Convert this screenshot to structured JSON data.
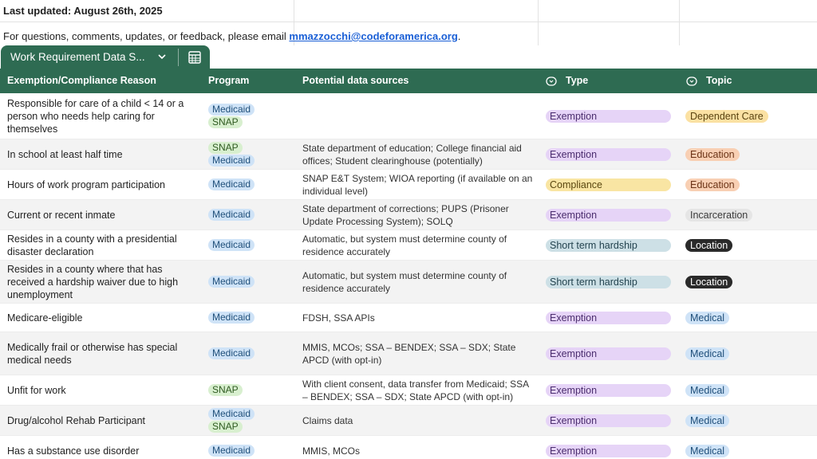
{
  "sheet": {
    "last_updated": "Last updated: August 26th, 2025",
    "contact_prefix": "For questions, comments, updates, or feedback, please email ",
    "contact_email": "mmazzocchi@codeforamerica.org",
    "contact_suffix": "."
  },
  "tab": {
    "name": "Work Requirement Data S...",
    "chevron_icon": "chevron-down-icon",
    "view_icon": "table-calendar-icon"
  },
  "colors": {
    "header_bg": "#2e6b52",
    "medicaid": "#cfe3f7",
    "snap": "#d8efcf",
    "exemption": "#e6d4f7",
    "compliance": "#f9e5a3",
    "short_term_hardship": "#cde0e6",
    "dependent_care": "#fbe1a3",
    "education": "#f8cfb3",
    "incarceration": "#e5e5e5",
    "location": "#2a2a2a",
    "medical": "#cfe3f7"
  },
  "table": {
    "columns": {
      "reason": "Exemption/Compliance Reason",
      "program": "Program",
      "sources": "Potential data sources",
      "type": "Type",
      "topic": "Topic"
    },
    "rows": [
      {
        "reason": "Responsible for care of a child < 14 or a person who needs help caring for themselves",
        "programs": [
          "Medicaid",
          "SNAP"
        ],
        "sources": "",
        "type": "Exemption",
        "topic": "Dependent Care"
      },
      {
        "reason": "In school at least half time",
        "programs": [
          "SNAP",
          "Medicaid"
        ],
        "sources": "State department of education; College financial aid offices; Student clearinghouse (potentially)",
        "type": "Exemption",
        "topic": "Education"
      },
      {
        "reason": "Hours of work program participation",
        "programs": [
          "Medicaid"
        ],
        "sources": "SNAP E&T System; WIOA reporting (if available on an individual level)",
        "type": "Compliance",
        "topic": "Education"
      },
      {
        "reason": "Current or recent inmate",
        "programs": [
          "Medicaid"
        ],
        "sources": "State department of corrections; PUPS (Prisoner Update Processing System); SOLQ",
        "type": "Exemption",
        "topic": "Incarceration"
      },
      {
        "reason": "Resides in a county with a presidential disaster declaration",
        "programs": [
          "Medicaid"
        ],
        "sources": "Automatic, but system must determine county of residence accurately",
        "type": "Short term hardship",
        "topic": "Location"
      },
      {
        "reason": "Resides in a county where that has received a hardship waiver due to high unemployment",
        "programs": [
          "Medicaid"
        ],
        "sources": "Automatic, but system must determine county of residence accurately",
        "type": "Short term hardship",
        "topic": "Location"
      },
      {
        "reason": "Medicare-eligible",
        "programs": [
          "Medicaid"
        ],
        "sources": "FDSH, SSA APIs",
        "type": "Exemption",
        "topic": "Medical"
      },
      {
        "reason": "Medically frail or otherwise has special medical needs",
        "programs": [
          "Medicaid"
        ],
        "sources": "MMIS, MCOs; SSA – BENDEX; SSA – SDX; State APCD (with opt-in)",
        "type": "Exemption",
        "topic": "Medical"
      },
      {
        "reason": "Unfit for work",
        "programs": [
          "SNAP"
        ],
        "sources": "With client consent, data transfer from Medicaid; SSA – BENDEX; SSA – SDX; State APCD (with opt-in)",
        "type": "Exemption",
        "topic": "Medical"
      },
      {
        "reason": "Drug/alcohol Rehab Participant",
        "programs": [
          "Medicaid",
          "SNAP"
        ],
        "sources": "Claims data",
        "type": "Exemption",
        "topic": "Medical"
      },
      {
        "reason": "Has a substance use disorder",
        "programs": [
          "Medicaid"
        ],
        "sources": "MMIS, MCOs",
        "type": "Exemption",
        "topic": "Medical"
      }
    ]
  }
}
